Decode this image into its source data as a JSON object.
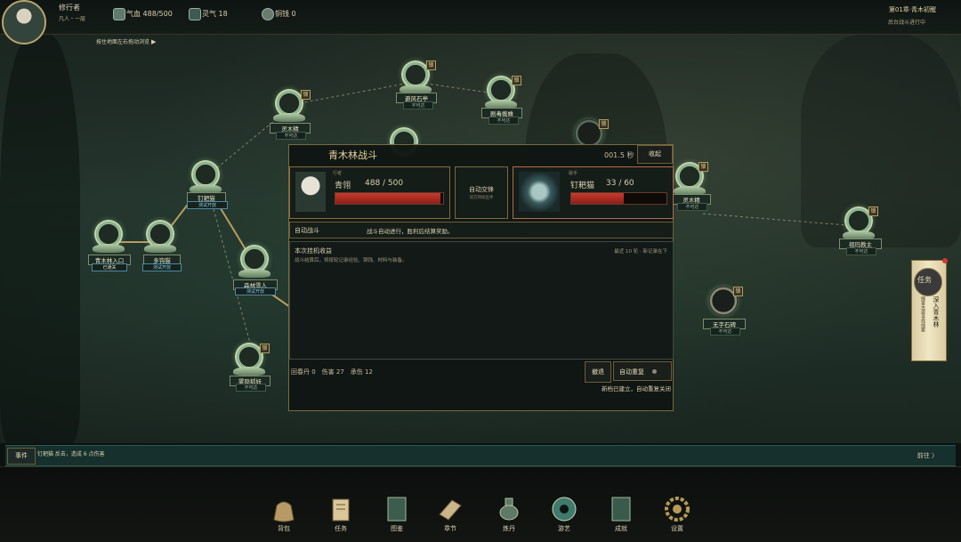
{
  "player": {
    "name": "修行者",
    "rank": "凡人・一层"
  },
  "resources": {
    "qixue_label": "气血",
    "qixue_value": "488/500",
    "lingqi_label": "灵气",
    "lingqi_value": "18",
    "tongqian_label": "铜钱",
    "tongqian_value": "0"
  },
  "chapter": {
    "title": "第01章·青木初醒",
    "status": "后台战斗进行中"
  },
  "map_hint": "按住地面左右拖动浏览",
  "lock_text": "锁",
  "nodes": [
    {
      "name": "青木林入口",
      "status": "已通关"
    },
    {
      "name": "多钩猫",
      "status": "测试开放"
    },
    {
      "name": "钉耙猫",
      "status": "测试开放"
    },
    {
      "name": "森林雪人",
      "status": "测试开放"
    },
    {
      "name": "雾隐狐妖",
      "status": "不可达"
    },
    {
      "name": "灵木精",
      "status": "不可达"
    },
    {
      "name": "避风石亭",
      "status": "不可达"
    },
    {
      "name": "剧毒蜘蛛",
      "status": "不可达"
    },
    {
      "name": "灵木精",
      "status": "不可达"
    },
    {
      "name": "祖玛教主",
      "status": "不可达"
    },
    {
      "name": "无字石碑",
      "status": "不可达"
    }
  ],
  "battle": {
    "title": "青木林战斗",
    "timer": "001.5 秒",
    "collapse": "收起",
    "player_tag": "行者",
    "player_name": "青翎",
    "player_hp": "488 / 500",
    "player_hp_ratio": 0.976,
    "auto_label": "自动交锋",
    "auto_sub": "双方持续出手",
    "enemy_tag": "敌手",
    "enemy_name": "钉耙猫",
    "enemy_hp": "33 / 60",
    "enemy_hp_ratio": 0.55,
    "mode": "自动战斗",
    "mode_desc": "战斗自动进行，胜利后结算奖励。",
    "income_title": "本次挂机收益",
    "income_desc": "战斗结算后，将按轮记录经验、铜钱、材料与装备。",
    "income_note": "最近 10 轮 · 新记录在下",
    "stats": "回春丹 0　伤害 27　承伤 12",
    "retreat": "撤退",
    "auto_repeat": "自动重复",
    "footer_note": "新档已建立，自动重复关闭"
  },
  "task_scroll": {
    "tag": "任务",
    "lines": [
      "深入青木林",
      "探查古迹寻找线索"
    ]
  },
  "event": {
    "label": "事件",
    "text": "钉耙猫 反击，造成 6 点伤害",
    "go": "前往 〉"
  },
  "bottom_menu": [
    "背包",
    "任务",
    "图鉴",
    "章节",
    "炼丹",
    "游艺",
    "成就",
    "设置"
  ],
  "colors": {
    "accent": "#c8a862",
    "hp": "#c8392e",
    "event_bar": "#16302d"
  }
}
